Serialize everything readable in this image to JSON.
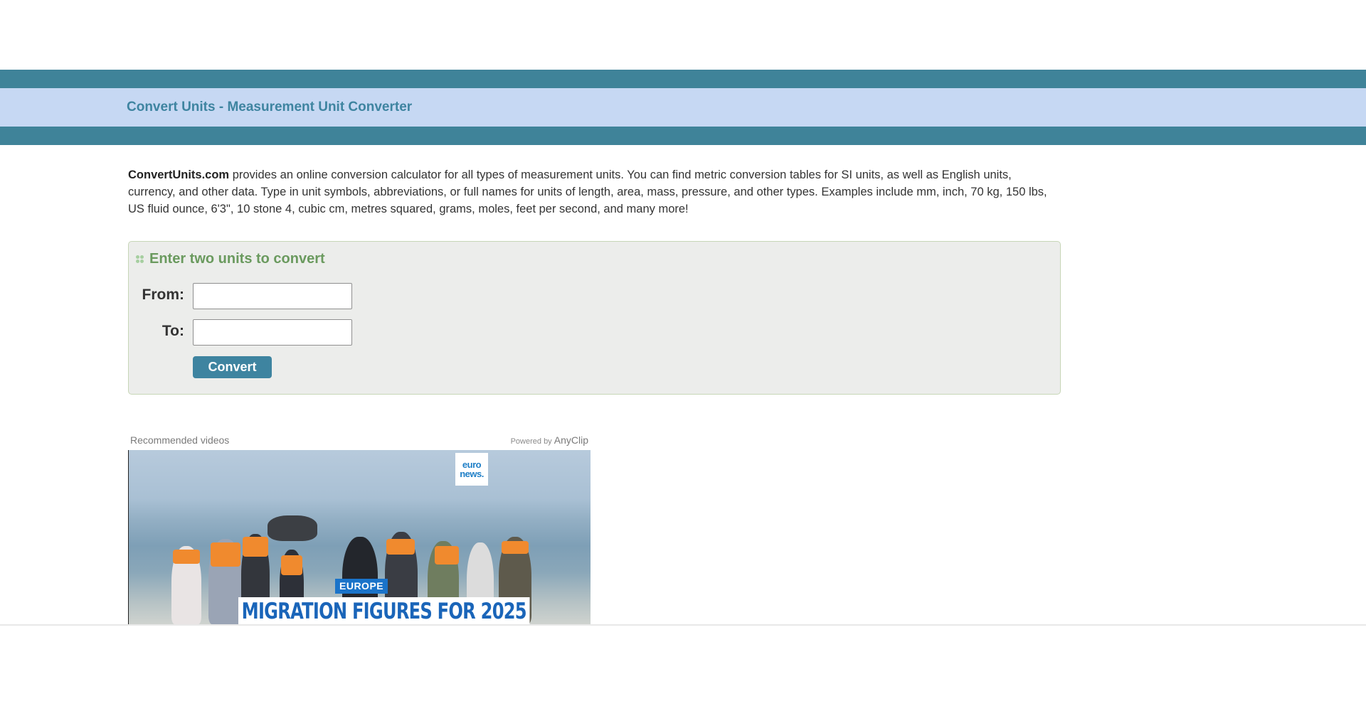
{
  "header": {
    "title": "Convert Units - Measurement Unit Converter"
  },
  "intro": {
    "brand": "ConvertUnits.com",
    "text": " provides an online conversion calculator for all types of measurement units. You can find metric conversion tables for SI units, as well as English units, currency, and other data. Type in unit symbols, abbreviations, or full names for units of length, area, mass, pressure, and other types. Examples include mm, inch, 70 kg, 150 lbs, US fluid ounce, 6'3\", 10 stone 4, cubic cm, metres squared, grams, moles, feet per second, and many more!"
  },
  "converter": {
    "heading": "Enter two units to convert",
    "from_label": "From:",
    "from_value": "",
    "to_label": "To:",
    "to_value": "",
    "button_label": "Convert"
  },
  "video": {
    "section_label": "Recommended videos",
    "powered_prefix": "Powered by",
    "powered_brand": "AnyClip",
    "logo_line1": "euro",
    "logo_line2": "news.",
    "category": "EUROPE",
    "headline": "MIGRATION FIGURES FOR 2025"
  },
  "colors": {
    "header_band": "#3f8399",
    "title_strip": "#c6d8f3",
    "accent": "#3e84a0",
    "panel_heading": "#6a9a5e"
  }
}
